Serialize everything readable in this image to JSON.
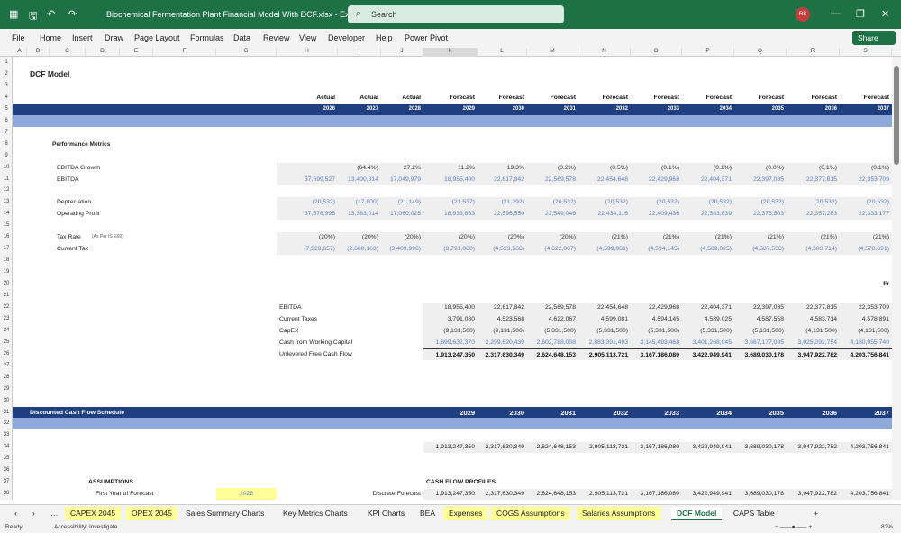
{
  "app": {
    "title": "Biochemical Fermentation Plant Financial Model With DCF.xlsx  -  Excel",
    "search_placeholder": "Search",
    "user_initials": "RS",
    "share_label": "Share"
  },
  "menu": [
    "File",
    "Home",
    "Insert",
    "Draw",
    "Page Layout",
    "Formulas",
    "Data",
    "Review",
    "View",
    "Developer",
    "Help",
    "Power Pivot"
  ],
  "columns": [
    "A",
    "B",
    "C",
    "D",
    "E",
    "F",
    "G",
    "H",
    "I",
    "J",
    "K",
    "L",
    "M",
    "N",
    "O",
    "P",
    "Q",
    "R",
    "S"
  ],
  "sheet": {
    "title": "DCF Model",
    "period_types": [
      "Actual",
      "Actual",
      "Actual",
      "Forecast",
      "Forecast",
      "Forecast",
      "Forecast",
      "Forecast",
      "Forecast",
      "Forecast",
      "Forecast",
      "Forecast"
    ],
    "years": [
      "2026",
      "2027",
      "2028",
      "2029",
      "2030",
      "2031",
      "2032",
      "2033",
      "2034",
      "2035",
      "2036",
      "2037"
    ],
    "section_performance": "Performance Metrics",
    "metrics": [
      {
        "row": 10,
        "label": "EBITDA Growth",
        "start": "I",
        "tone": "dark",
        "values": [
          "(64.4%)",
          "27.2%",
          "11.2%",
          "19.3%",
          "(0.2%)",
          "(0.5%)",
          "(0.1%)",
          "(0.1%)",
          "(0.0%)",
          "(0.1%)",
          "(0.1%)"
        ]
      },
      {
        "row": 11,
        "label": "EBITDA",
        "start": "H",
        "tone": "blue",
        "values": [
          "37,599,527",
          "13,400,814",
          "17,049,979",
          "18,955,400",
          "22,617,842",
          "22,569,578",
          "22,454,648",
          "22,429,968",
          "22,404,371",
          "22,397,035",
          "22,377,815",
          "22,353,709"
        ]
      },
      {
        "row": 13,
        "label": "Depreciation",
        "start": "H",
        "tone": "blue",
        "values": [
          "(20,532)",
          "(17,800)",
          "(21,149)",
          "(21,537)",
          "(21,292)",
          "(20,532)",
          "(20,532)",
          "(20,532)",
          "(20,532)",
          "(20,532)",
          "(20,532)",
          "(20,532)"
        ]
      },
      {
        "row": 14,
        "label": "Operating Profit",
        "start": "H",
        "tone": "blue",
        "values": [
          "37,578,995",
          "13,383,014",
          "17,060,028",
          "18,933,863",
          "22,596,550",
          "22,549,046",
          "22,434,116",
          "22,409,436",
          "22,383,839",
          "22,376,503",
          "22,357,283",
          "22,333,177"
        ]
      },
      {
        "row": 16,
        "label": "Tax Rate",
        "label_note": "(As Per IS E69)",
        "start": "H",
        "tone": "dark",
        "values": [
          "(20%)",
          "(20%)",
          "(20%)",
          "(20%)",
          "(20%)",
          "(20%)",
          "(21%)",
          "(21%)",
          "(21%)",
          "(21%)",
          "(21%)",
          "(21%)"
        ]
      },
      {
        "row": 17,
        "label": "Current Tax",
        "start": "H",
        "tone": "blue",
        "values": [
          "(7,529,657)",
          "(2,680,163)",
          "(3,409,996)",
          "(3,791,080)",
          "(4,523,568)",
          "(4,622,067)",
          "(4,599,081)",
          "(4,594,145)",
          "(4,589,025)",
          "(4,587,558)",
          "(4,583,714)",
          "(4,578,891)"
        ]
      }
    ],
    "fcf_header_fragment": "Fr",
    "fcf": [
      {
        "row": 22,
        "label": "EBITDA",
        "tone": "dark",
        "values": [
          "18,955,400",
          "22,617,842",
          "22,569,578",
          "22,454,648",
          "22,429,968",
          "22,404,371",
          "22,397,035",
          "22,377,815",
          "22,353,709"
        ]
      },
      {
        "row": 23,
        "label": "Current Taxes",
        "tone": "dark",
        "values": [
          "3,791,080",
          "4,523,568",
          "4,622,067",
          "4,599,081",
          "4,594,145",
          "4,589,025",
          "4,587,558",
          "4,583,714",
          "4,578,891"
        ]
      },
      {
        "row": 24,
        "label": "CapEX",
        "tone": "dark",
        "values": [
          "(9,131,500)",
          "(9,131,500)",
          "(5,331,500)",
          "(5,331,500)",
          "(5,331,500)",
          "(5,331,500)",
          "(5,131,500)",
          "(4,131,500)",
          "(4,131,500)"
        ]
      },
      {
        "row": 25,
        "label": "Cash from Working Capital",
        "tone": "blue",
        "values": [
          "1,899,632,370",
          "2,299,620,439",
          "2,602,788,008",
          "2,883,391,493",
          "3,145,493,468",
          "3,401,268,045",
          "3,667,177,085",
          "3,925,092,754",
          "4,180,955,740"
        ]
      },
      {
        "row": 26,
        "label": "Unlevered Free Cash Flow",
        "tone": "bold",
        "values": [
          "1,913,247,350",
          "2,317,630,349",
          "2,624,648,153",
          "2,905,113,721",
          "3,167,186,080",
          "3,422,949,941",
          "3,689,030,178",
          "3,947,922,782",
          "4,203,756,841"
        ]
      }
    ],
    "dcf_title": "Discounted Cash Flow Schedule",
    "dcf_years": [
      "2029",
      "2030",
      "2031",
      "2032",
      "2033",
      "2034",
      "2035",
      "2036",
      "2037"
    ],
    "dcf_row34": [
      "1,913,247,350",
      "2,317,630,349",
      "2,624,648,153",
      "2,905,113,721",
      "3,167,186,080",
      "3,422,949,941",
      "3,689,030,178",
      "3,947,922,782",
      "4,203,756,841"
    ],
    "assumptions_title": "ASSUMPTIONS",
    "first_year_label": "First Year of Forecast",
    "first_year_value": "2028",
    "cash_flow_profiles_title": "CASH FLOW PROFILES",
    "discrete_forecast_label": "Discrete Forecast",
    "discrete_forecast": [
      "1,913,247,350",
      "2,317,630,349",
      "2,624,648,153",
      "2,905,113,721",
      "3,167,186,080",
      "3,422,949,941",
      "3,689,030,178",
      "3,947,922,782",
      "4,203,756,841"
    ]
  },
  "tabs": [
    {
      "label": "CAPEX 2045",
      "highlight": true
    },
    {
      "label": "OPEX 2045",
      "highlight": true
    },
    {
      "label": "Sales Summary Charts",
      "highlight": false
    },
    {
      "label": "Key Metrics Charts",
      "highlight": false
    },
    {
      "label": "KPI Charts",
      "highlight": false
    },
    {
      "label": "BEA",
      "highlight": false
    },
    {
      "label": "Expenses",
      "highlight": true
    },
    {
      "label": "COGS Assumptions",
      "highlight": true
    },
    {
      "label": "Salaries Assumptions",
      "highlight": true
    },
    {
      "label": "DCF Model",
      "highlight": false,
      "active": true
    },
    {
      "label": "CAPS Table",
      "highlight": false
    }
  ],
  "status": {
    "ready": "Ready",
    "accessibility": "Accessibility: Investigate",
    "zoom": "82%"
  },
  "colors": {
    "brand": "#1e7145",
    "band_dark": "#203f80",
    "band_light": "#8eaadb",
    "input_blue": "#4472c4",
    "highlight": "#ffff99"
  }
}
